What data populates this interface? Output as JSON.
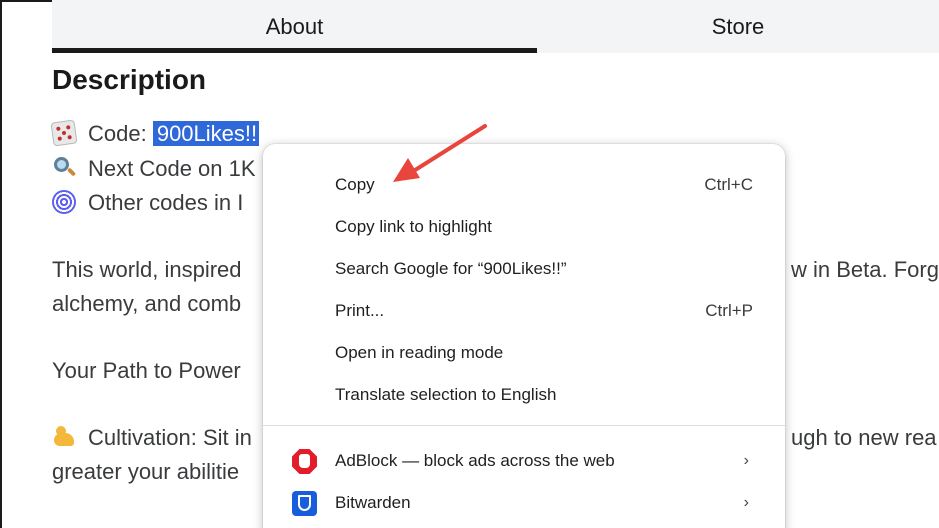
{
  "tabs": [
    {
      "label": "About",
      "active": true
    },
    {
      "label": "Store",
      "active": false
    }
  ],
  "description": {
    "heading": "Description",
    "lines": [
      {
        "icon": "dice-icon",
        "prefix": "Code: ",
        "highlight": "900Likes!!"
      },
      {
        "icon": "magnifier-icon",
        "text": "Next Code on 1K"
      },
      {
        "icon": "spiral-icon",
        "text": "Other codes in I"
      },
      {
        "text": "This world, inspired"
      },
      {
        "text": "w in Beta. Forg"
      },
      {
        "text": "alchemy, and comb"
      },
      {
        "text": "Your Path to Power"
      },
      {
        "icon": "flexed-biceps-icon",
        "text": "Cultivation: Sit in"
      },
      {
        "text": "ugh to new rea"
      },
      {
        "text": "greater your abilitie"
      }
    ]
  },
  "context_menu": {
    "items": [
      {
        "label": "Copy",
        "shortcut": "Ctrl+C"
      },
      {
        "label": "Copy link to highlight"
      },
      {
        "label": "Search Google for “900Likes!!”"
      },
      {
        "label": "Print...",
        "shortcut": "Ctrl+P"
      },
      {
        "label": "Open in reading mode"
      },
      {
        "label": "Translate selection to English"
      }
    ],
    "extensions": [
      {
        "label": "AdBlock — block ads across the web",
        "icon": "adblock-icon",
        "submenu": "›"
      },
      {
        "label": "Bitwarden",
        "icon": "bitwarden-icon",
        "submenu": "›"
      }
    ]
  },
  "colors": {
    "selection": "#2f68d8",
    "annotation_arrow": "#e8453c",
    "adblock": "#e21c2a",
    "bitwarden": "#175ddc"
  }
}
